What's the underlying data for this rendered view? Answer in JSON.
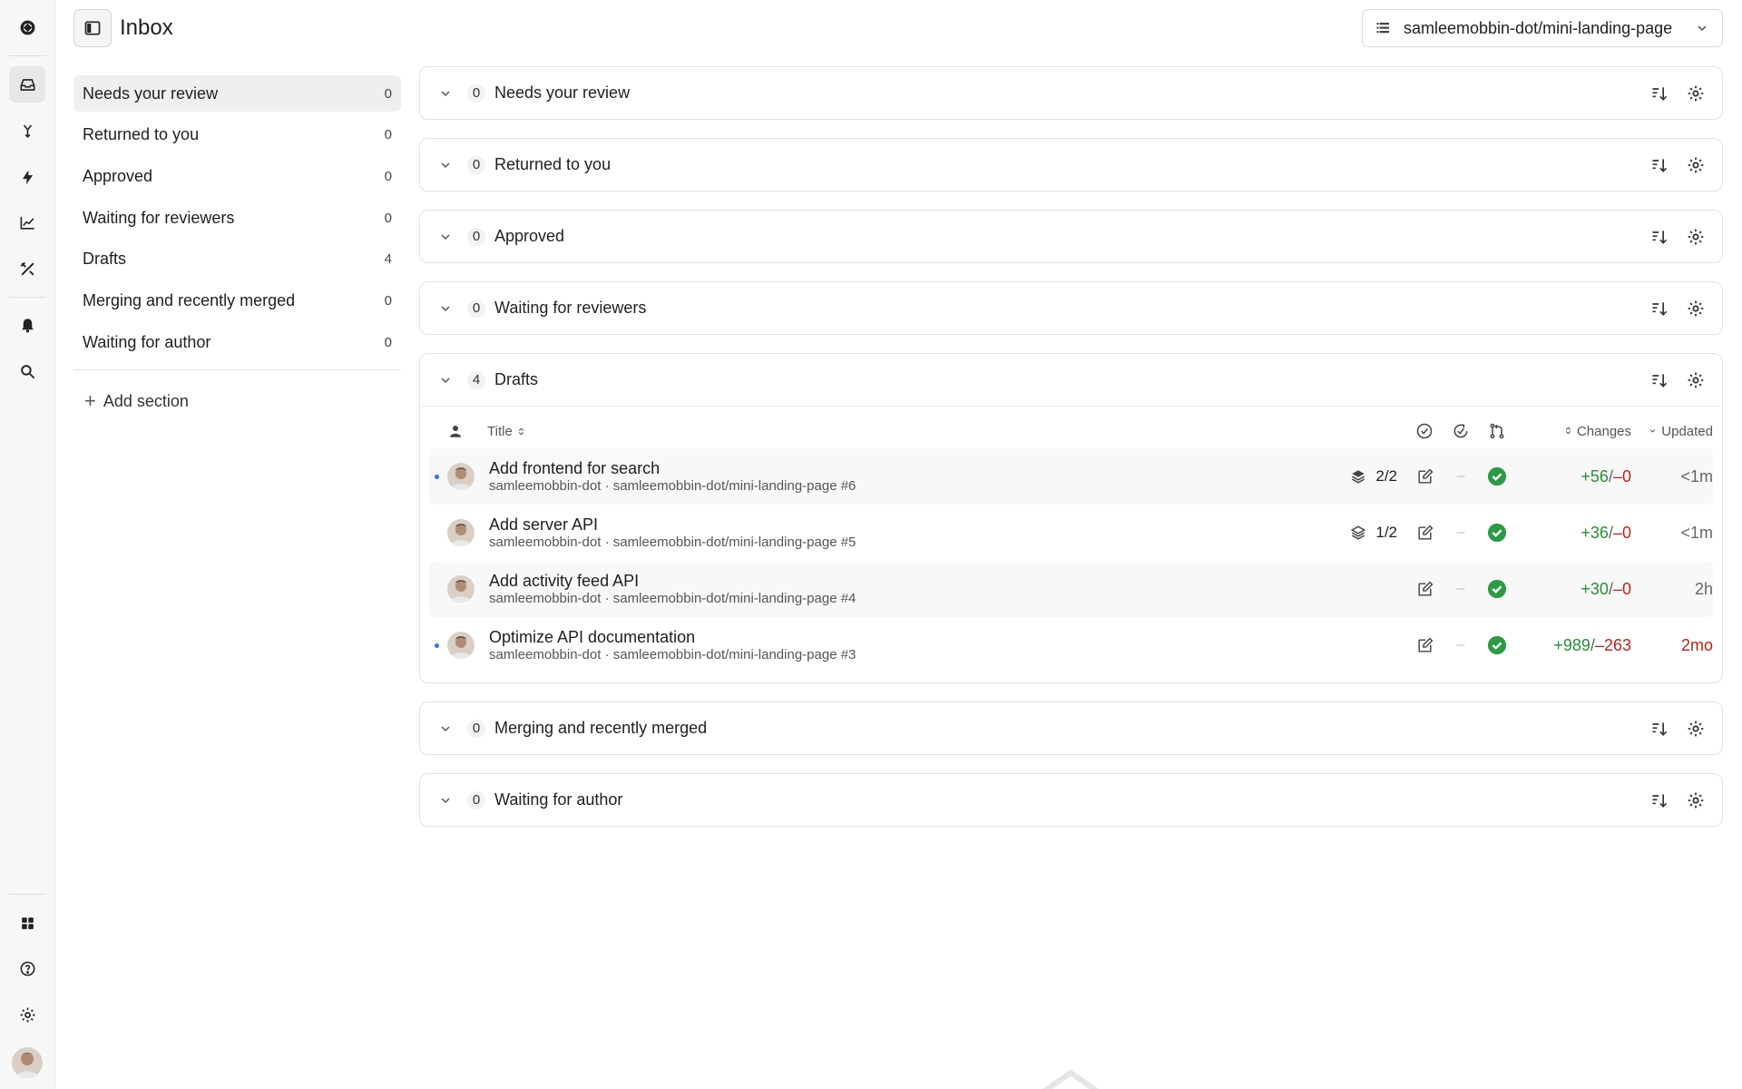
{
  "header": {
    "title": "Inbox",
    "repo": "samleemobbin-dot/mini-landing-page"
  },
  "nav": {
    "items": [
      {
        "label": "Needs your review",
        "count": "0"
      },
      {
        "label": "Returned to you",
        "count": "0"
      },
      {
        "label": "Approved",
        "count": "0"
      },
      {
        "label": "Waiting for reviewers",
        "count": "0"
      },
      {
        "label": "Drafts",
        "count": "4"
      },
      {
        "label": "Merging and recently merged",
        "count": "0"
      },
      {
        "label": "Waiting for author",
        "count": "0"
      }
    ],
    "add_section": "Add section"
  },
  "sections": {
    "needs_review": {
      "count": "0",
      "title": "Needs your review"
    },
    "returned": {
      "count": "0",
      "title": "Returned to you"
    },
    "approved": {
      "count": "0",
      "title": "Approved"
    },
    "waiting_reviewers": {
      "count": "0",
      "title": "Waiting for reviewers"
    },
    "drafts": {
      "count": "4",
      "title": "Drafts",
      "columns": {
        "title": "Title",
        "changes": "Changes",
        "updated": "Updated"
      },
      "rows": [
        {
          "title": "Add frontend for search",
          "sub": "samleemobbin-dot · samleemobbin-dot/mini-landing-page #6",
          "stack": "2/2",
          "check_dash": "–",
          "added": "+56",
          "slash": "/",
          "removed": "–0",
          "updated": "<1m"
        },
        {
          "title": "Add server API",
          "sub": "samleemobbin-dot · samleemobbin-dot/mini-landing-page #5",
          "stack": "1/2",
          "check_dash": "–",
          "added": "+36",
          "slash": "/",
          "removed": "–0",
          "updated": "<1m"
        },
        {
          "title": "Add activity feed API",
          "sub": "samleemobbin-dot · samleemobbin-dot/mini-landing-page #4",
          "check_dash": "–",
          "added": "+30",
          "slash": "/",
          "removed": "–0",
          "updated": "2h"
        },
        {
          "title": "Optimize API documentation",
          "sub": "samleemobbin-dot · samleemobbin-dot/mini-landing-page #3",
          "check_dash": "–",
          "added": "+989",
          "slash": "/",
          "removed": "–263",
          "updated": "2mo"
        }
      ]
    },
    "merging": {
      "count": "0",
      "title": "Merging and recently merged"
    },
    "waiting_author": {
      "count": "0",
      "title": "Waiting for author"
    }
  },
  "colors": {
    "added": "#2e8b3a",
    "removed": "#b3261e",
    "success": "#2e9a46",
    "unread_dot": "#3b6fd8"
  },
  "icons": {
    "rail": [
      "logo-icon",
      "inbox-icon",
      "merge-icon",
      "bolt-icon",
      "chart-icon",
      "tools-icon",
      "bell-icon",
      "search-icon",
      "apps-icon",
      "help-icon",
      "settings-icon"
    ]
  }
}
